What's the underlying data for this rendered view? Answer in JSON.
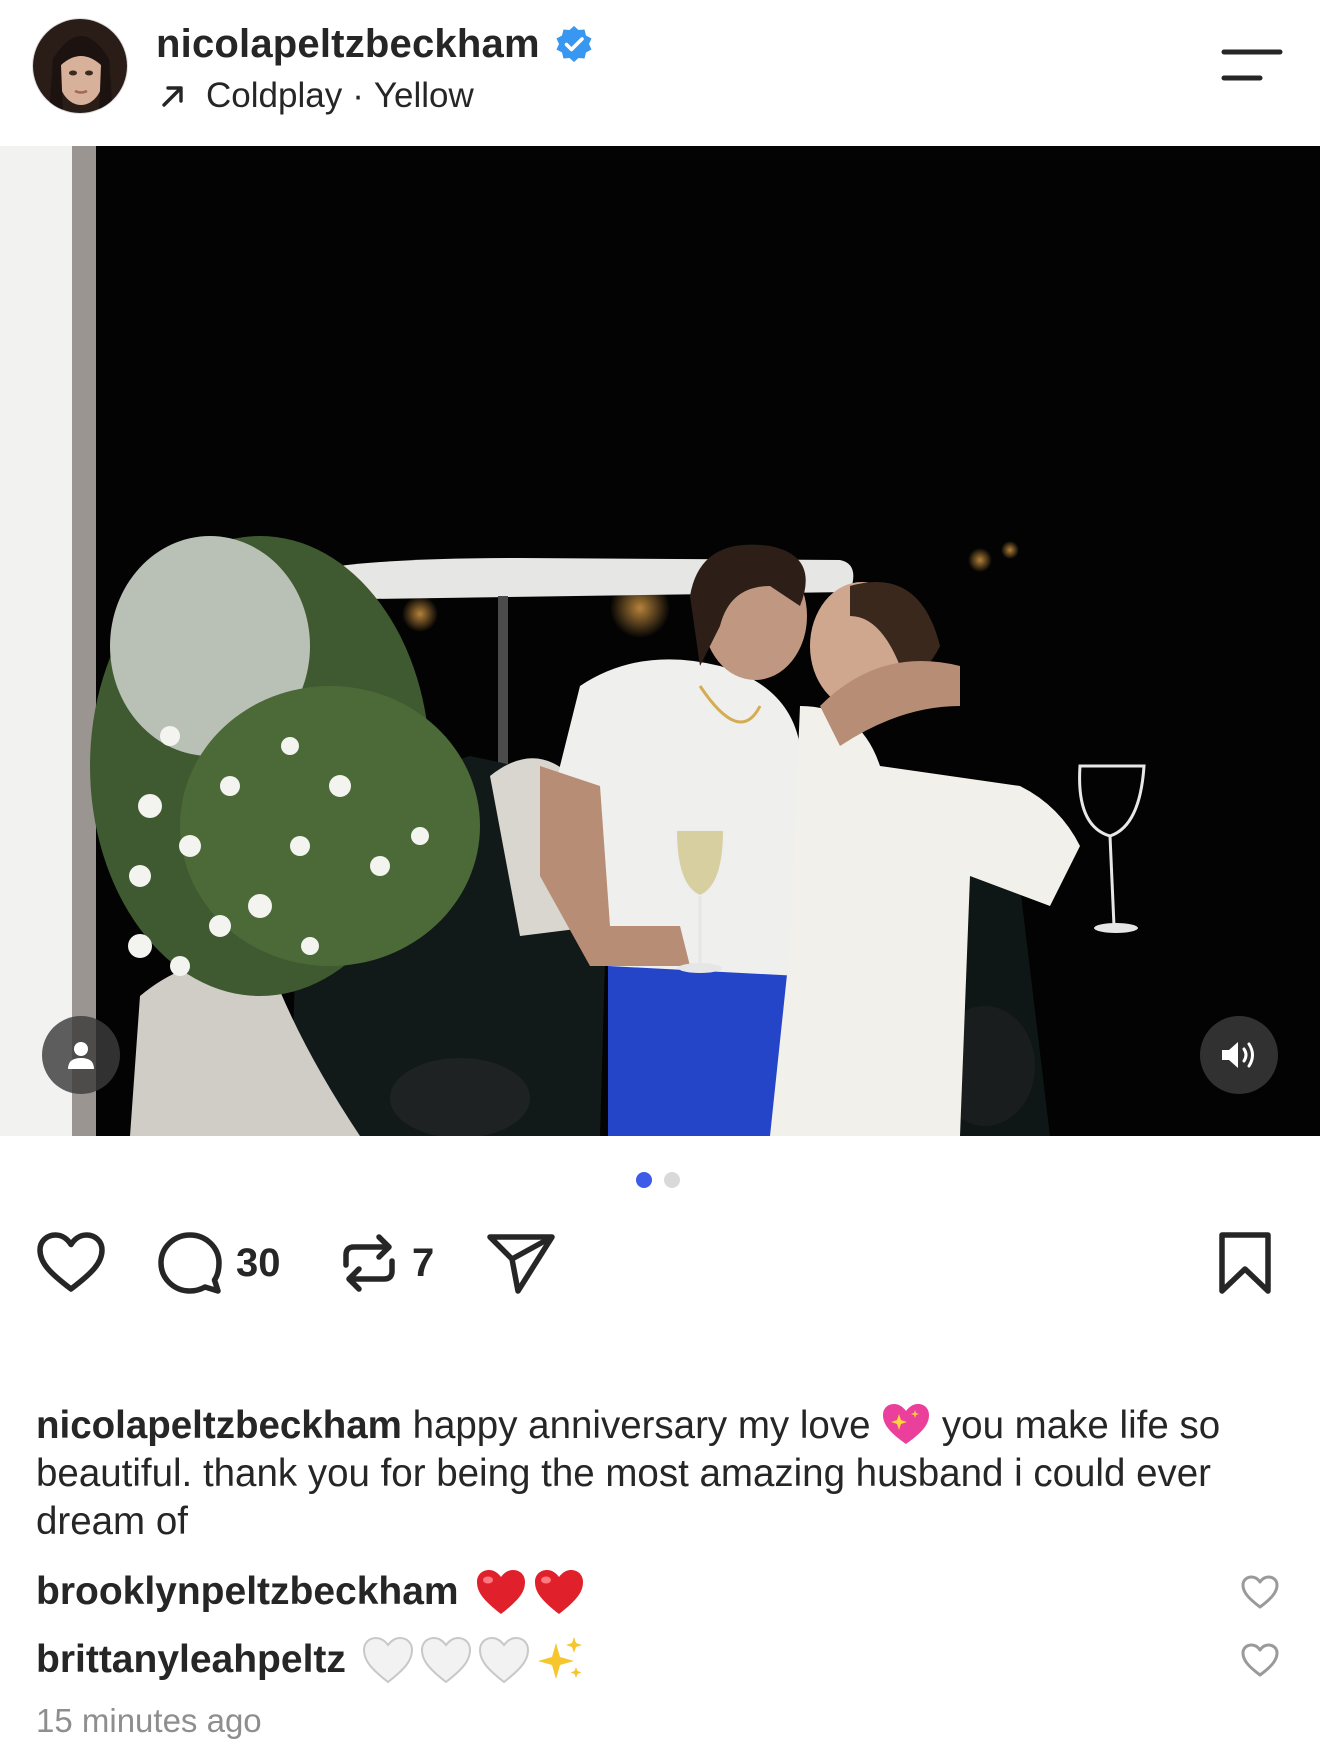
{
  "header": {
    "username": "nicolapeltzbeckham",
    "music_artist": "Coldplay",
    "music_separator": "·",
    "music_title": "Yellow"
  },
  "media": {
    "carousel_total": 2,
    "carousel_active": 1
  },
  "actions": {
    "comments_count": "30",
    "reposts_count": "7"
  },
  "caption": {
    "username": "nicolapeltzbeckham",
    "text_before_emoji": " happy anniversary my love ",
    "emoji": "sparkling-heart-emoji",
    "text_after_emoji": " you make life so beautiful. thank you for being the most amazing husband i could ever dream of"
  },
  "comments": [
    {
      "username": "brooklynpeltzbeckham",
      "emojis": [
        "red-heart-emoji",
        "red-heart-emoji"
      ]
    },
    {
      "username": "brittanyleahpeltz",
      "emojis": [
        "white-heart-emoji",
        "white-heart-emoji",
        "white-heart-emoji",
        "sparkles-emoji"
      ]
    }
  ],
  "timestamp": "15 minutes ago",
  "colors": {
    "verified_badge": "#3897f0",
    "carousel_active_dot": "#3b5be8",
    "carousel_inactive_dot": "#d9d9d9",
    "text_primary": "#262626",
    "text_secondary": "#8e8e8e"
  }
}
